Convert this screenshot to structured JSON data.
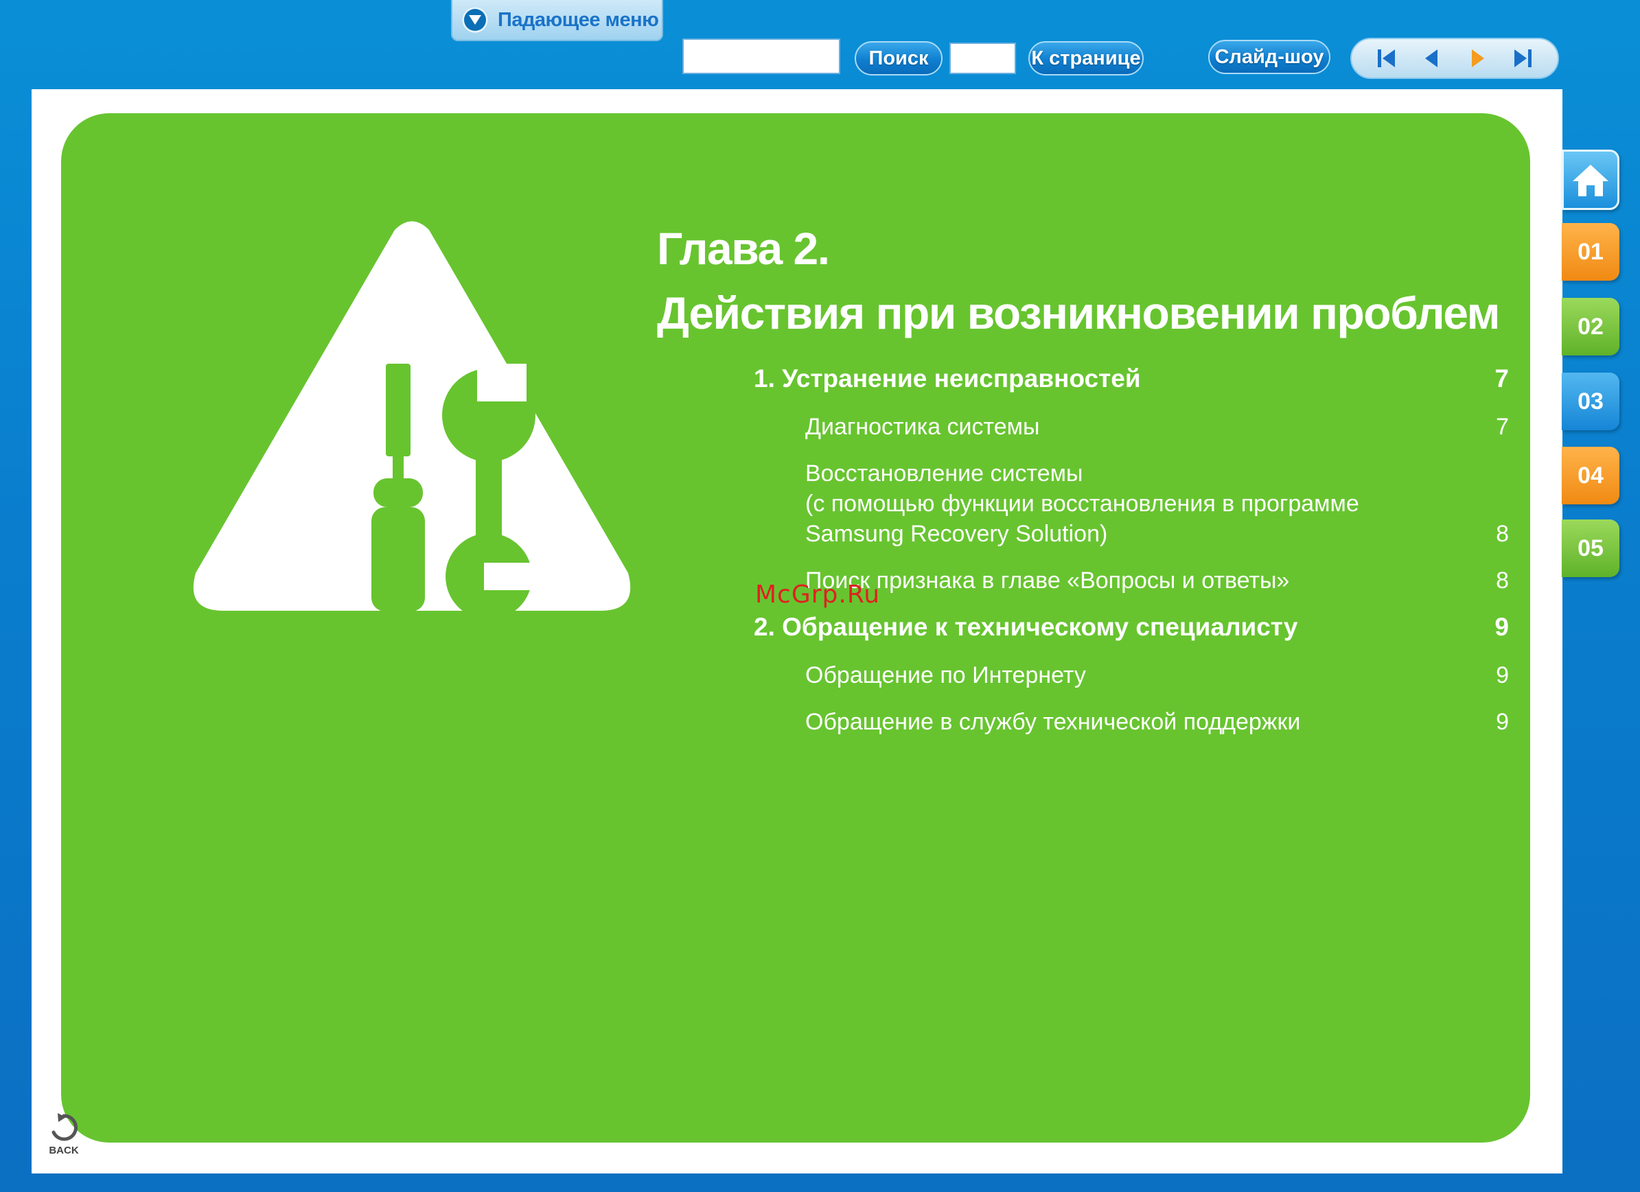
{
  "toolbar": {
    "dropdown_label": "Падающее меню",
    "search_label": "Поиск",
    "goto_page_label": "К странице",
    "slideshow_label": "Слайд-шоу",
    "search_value": "",
    "page_value": "",
    "nav_icons": [
      "first-page-icon",
      "prev-page-icon",
      "next-page-icon",
      "last-page-icon"
    ]
  },
  "chapter": {
    "title_line1": "Глава 2.",
    "title_line2": "Действия при возникновении проблем",
    "icon": "warning-triangle-tools-icon",
    "toc": [
      {
        "title": "1. Устранение неисправностей",
        "page": "7",
        "level": "section"
      },
      {
        "title": "Диагностика системы",
        "page": "7",
        "level": "sub"
      },
      {
        "title": "Восстановление системы\n(с помощью функции восстановления в программе\nSamsung Recovery Solution)",
        "page": "8",
        "level": "sub"
      },
      {
        "title": "Поиск признака в главе «Вопросы и ответы»",
        "page": "8",
        "level": "sub"
      },
      {
        "title": "2. Обращение к техническому специалисту",
        "page": "9",
        "level": "section"
      },
      {
        "title": "Обращение по Интернету",
        "page": "9",
        "level": "sub"
      },
      {
        "title": "Обращение в службу технической поддержки",
        "page": "9",
        "level": "sub"
      }
    ]
  },
  "side_tabs": [
    {
      "label": "",
      "icon": "home-icon"
    },
    {
      "label": "01"
    },
    {
      "label": "02"
    },
    {
      "label": "03"
    },
    {
      "label": "04"
    },
    {
      "label": "05"
    }
  ],
  "back_label": "BACK",
  "watermark": "McGrp.Ru",
  "colors": {
    "background": "#0a7fce",
    "panel_green": "#67c42f",
    "tab_orange": "#f08a13",
    "tab_green": "#5fb22a",
    "tab_blue": "#1585d6"
  }
}
